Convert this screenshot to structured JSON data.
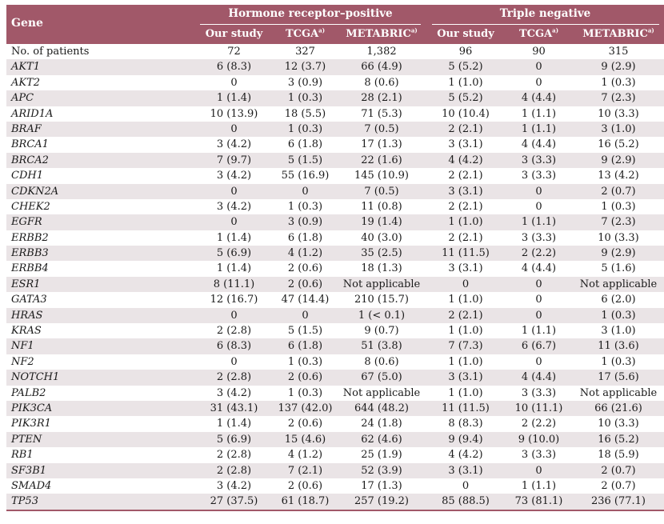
{
  "header": {
    "gene": "Gene",
    "groups": [
      "Hormone receptor–positive",
      "Triple negative"
    ],
    "columns": [
      {
        "label": "Our study",
        "sup": ""
      },
      {
        "label": "TCGA",
        "sup": "a)"
      },
      {
        "label": "METABRIC",
        "sup": "a)"
      },
      {
        "label": "Our study",
        "sup": ""
      },
      {
        "label": "TCGA",
        "sup": "a)"
      },
      {
        "label": "METABRIC",
        "sup": "a)"
      }
    ]
  },
  "rows": [
    {
      "gene": "No. of patients",
      "italic": false,
      "values": [
        "72",
        "327",
        "1,382",
        "96",
        "90",
        "315"
      ]
    },
    {
      "gene": "AKT1",
      "italic": true,
      "values": [
        "6 (8.3)",
        "12 (3.7)",
        "66 (4.9)",
        "5 (5.2)",
        "0",
        "9 (2.9)"
      ]
    },
    {
      "gene": "AKT2",
      "italic": true,
      "values": [
        "0",
        "3 (0.9)",
        "8 (0.6)",
        "1 (1.0)",
        "0",
        "1 (0.3)"
      ]
    },
    {
      "gene": "APC",
      "italic": true,
      "values": [
        "1 (1.4)",
        "1 (0.3)",
        "28 (2.1)",
        "5 (5.2)",
        "4 (4.4)",
        "7 (2.3)"
      ]
    },
    {
      "gene": "ARID1A",
      "italic": true,
      "values": [
        "10 (13.9)",
        "18 (5.5)",
        "71 (5.3)",
        "10 (10.4)",
        "1 (1.1)",
        "10 (3.3)"
      ]
    },
    {
      "gene": "BRAF",
      "italic": true,
      "values": [
        "0",
        "1 (0.3)",
        "7 (0.5)",
        "2 (2.1)",
        "1 (1.1)",
        "3 (1.0)"
      ]
    },
    {
      "gene": "BRCA1",
      "italic": true,
      "values": [
        "3 (4.2)",
        "6 (1.8)",
        "17 (1.3)",
        "3 (3.1)",
        "4 (4.4)",
        "16 (5.2)"
      ]
    },
    {
      "gene": "BRCA2",
      "italic": true,
      "values": [
        "7 (9.7)",
        "5 (1.5)",
        "22 (1.6)",
        "4 (4.2)",
        "3 (3.3)",
        "9 (2.9)"
      ]
    },
    {
      "gene": "CDH1",
      "italic": true,
      "values": [
        "3 (4.2)",
        "55 (16.9)",
        "145 (10.9)",
        "2 (2.1)",
        "3 (3.3)",
        "13 (4.2)"
      ]
    },
    {
      "gene": "CDKN2A",
      "italic": true,
      "values": [
        "0",
        "0",
        "7 (0.5)",
        "3 (3.1)",
        "0",
        "2 (0.7)"
      ]
    },
    {
      "gene": "CHEK2",
      "italic": true,
      "values": [
        "3 (4.2)",
        "1 (0.3)",
        "11 (0.8)",
        "2 (2.1)",
        "0",
        "1 (0.3)"
      ]
    },
    {
      "gene": "EGFR",
      "italic": true,
      "values": [
        "0",
        "3 (0.9)",
        "19 (1.4)",
        "1 (1.0)",
        "1 (1.1)",
        "7 (2.3)"
      ]
    },
    {
      "gene": "ERBB2",
      "italic": true,
      "values": [
        "1 (1.4)",
        "6 (1.8)",
        "40 (3.0)",
        "2 (2.1)",
        "3 (3.3)",
        "10 (3.3)"
      ]
    },
    {
      "gene": "ERBB3",
      "italic": true,
      "values": [
        "5 (6.9)",
        "4 (1.2)",
        "35 (2.5)",
        "11 (11.5)",
        "2 (2.2)",
        "9 (2.9)"
      ]
    },
    {
      "gene": "ERBB4",
      "italic": true,
      "values": [
        "1 (1.4)",
        "2 (0.6)",
        "18 (1.3)",
        "3 (3.1)",
        "4 (4.4)",
        "5 (1.6)"
      ]
    },
    {
      "gene": "ESR1",
      "italic": true,
      "values": [
        "8 (11.1)",
        "2 (0.6)",
        "Not applicable",
        "0",
        "0",
        "Not applicable"
      ]
    },
    {
      "gene": "GATA3",
      "italic": true,
      "values": [
        "12 (16.7)",
        "47 (14.4)",
        "210 (15.7)",
        "1 (1.0)",
        "0",
        "6 (2.0)"
      ]
    },
    {
      "gene": "HRAS",
      "italic": true,
      "values": [
        "0",
        "0",
        "1 (< 0.1)",
        "2 (2.1)",
        "0",
        "1 (0.3)"
      ]
    },
    {
      "gene": "KRAS",
      "italic": true,
      "values": [
        "2 (2.8)",
        "5 (1.5)",
        "9 (0.7)",
        "1 (1.0)",
        "1 (1.1)",
        "3 (1.0)"
      ]
    },
    {
      "gene": "NF1",
      "italic": true,
      "values": [
        "6 (8.3)",
        "6 (1.8)",
        "51 (3.8)",
        "7 (7.3)",
        "6 (6.7)",
        "11 (3.6)"
      ]
    },
    {
      "gene": "NF2",
      "italic": true,
      "values": [
        "0",
        "1 (0.3)",
        "8 (0.6)",
        "1 (1.0)",
        "0",
        "1 (0.3)"
      ]
    },
    {
      "gene": "NOTCH1",
      "italic": true,
      "values": [
        "2 (2.8)",
        "2 (0.6)",
        "67 (5.0)",
        "3 (3.1)",
        "4 (4.4)",
        "17 (5.6)"
      ]
    },
    {
      "gene": "PALB2",
      "italic": true,
      "values": [
        "3 (4.2)",
        "1 (0.3)",
        "Not applicable",
        "1 (1.0)",
        "3 (3.3)",
        "Not applicable"
      ]
    },
    {
      "gene": "PIK3CA",
      "italic": true,
      "values": [
        "31 (43.1)",
        "137 (42.0)",
        "644 (48.2)",
        "11 (11.5)",
        "10 (11.1)",
        "66 (21.6)"
      ]
    },
    {
      "gene": "PIK3R1",
      "italic": true,
      "values": [
        "1 (1.4)",
        "2 (0.6)",
        "24 (1.8)",
        "8 (8.3)",
        "2 (2.2)",
        "10 (3.3)"
      ]
    },
    {
      "gene": "PTEN",
      "italic": true,
      "values": [
        "5 (6.9)",
        "15 (4.6)",
        "62 (4.6)",
        "9 (9.4)",
        "9 (10.0)",
        "16 (5.2)"
      ]
    },
    {
      "gene": "RB1",
      "italic": true,
      "values": [
        "2 (2.8)",
        "4 (1.2)",
        "25 (1.9)",
        "4 (4.2)",
        "3 (3.3)",
        "18 (5.9)"
      ]
    },
    {
      "gene": "SF3B1",
      "italic": true,
      "values": [
        "2 (2.8)",
        "7 (2.1)",
        "52 (3.9)",
        "3 (3.1)",
        "0",
        "2 (0.7)"
      ]
    },
    {
      "gene": "SMAD4",
      "italic": true,
      "values": [
        "3 (4.2)",
        "2 (0.6)",
        "17 (1.3)",
        "0",
        "1 (1.1)",
        "2 (0.7)"
      ]
    },
    {
      "gene": "TP53",
      "italic": true,
      "values": [
        "27 (37.5)",
        "61 (18.7)",
        "257 (19.2)",
        "85 (88.5)",
        "73 (81.1)",
        "236 (77.1)"
      ]
    }
  ],
  "colors": {
    "header_bg": "#a15869",
    "alt_row_bg": "#eae4e6",
    "rule": "#a15869"
  }
}
